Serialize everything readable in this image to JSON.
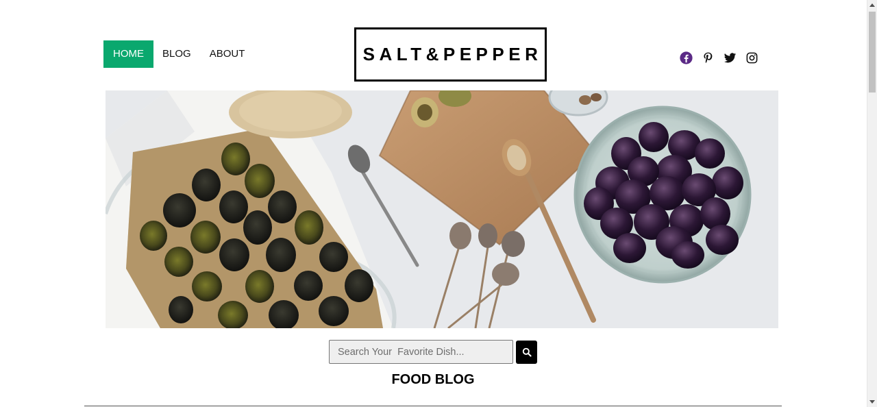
{
  "nav": {
    "items": [
      {
        "label": "HOME",
        "active": true
      },
      {
        "label": "BLOG",
        "active": false
      },
      {
        "label": "ABOUT",
        "active": false
      }
    ],
    "active_color": "#0aa86e"
  },
  "logo": {
    "text": "SALT&PEPPER"
  },
  "social": {
    "icons": [
      "facebook-icon",
      "pinterest-icon",
      "twitter-icon",
      "instagram-icon"
    ],
    "facebook_color": "#5b2a86"
  },
  "hero": {
    "icon": "food-photo"
  },
  "search": {
    "placeholder": "Search Your  Favorite Dish...",
    "value": "",
    "button_icon": "search-icon"
  },
  "section": {
    "title": "FOOD BLOG"
  }
}
